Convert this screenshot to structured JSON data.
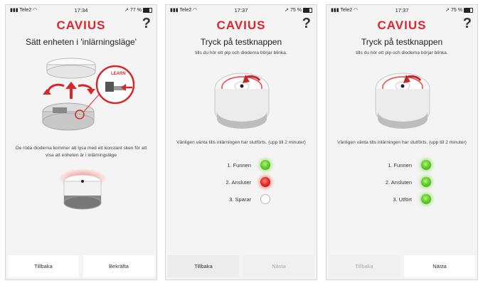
{
  "screens": [
    {
      "status": {
        "carrier": "Tele2",
        "time": "17:34",
        "battery": "77 %"
      },
      "logo": "CAVIUS",
      "help": "?",
      "title": "Sätt enheten i 'inlärningsläge'",
      "learn_label": "LEARN",
      "description": "De röda dioderna kommer att lysa med ett konstant sken för att visa att enheten är i inlärningsläge",
      "buttons": {
        "back": "Tillbaka",
        "confirm": "Bekräfta"
      }
    },
    {
      "status": {
        "carrier": "Tele2",
        "time": "17:37",
        "battery": "75 %"
      },
      "logo": "CAVIUS",
      "help": "?",
      "title": "Tryck på testknappen",
      "subtitle": "tills du hör ett pip och dioderna börjar blinka.",
      "wait": "Vänligen vänta tills inlärningen har slutförts. (upp till 2 minuter)",
      "steps": [
        {
          "label": "1. Funnen",
          "state": "green"
        },
        {
          "label": "2. Ansluter",
          "state": "red"
        },
        {
          "label": "3. Sparar",
          "state": "white"
        }
      ],
      "buttons": {
        "back": "Tillbaka",
        "next": "Nästa"
      }
    },
    {
      "status": {
        "carrier": "Tele2",
        "time": "17:37",
        "battery": "75 %"
      },
      "logo": "CAVIUS",
      "help": "?",
      "title": "Tryck på testknappen",
      "subtitle": "tills du hör ett pip och dioderna börjar blinka.",
      "wait": "Vänligen vänta tills inlärningen har slutförts. (upp till 2 minuter)",
      "steps": [
        {
          "label": "1. Funnen",
          "state": "green"
        },
        {
          "label": "2. Ansluten",
          "state": "green"
        },
        {
          "label": "3. Utfört",
          "state": "green"
        }
      ],
      "buttons": {
        "back": "Tillbaka",
        "next": "Nästa"
      }
    }
  ]
}
